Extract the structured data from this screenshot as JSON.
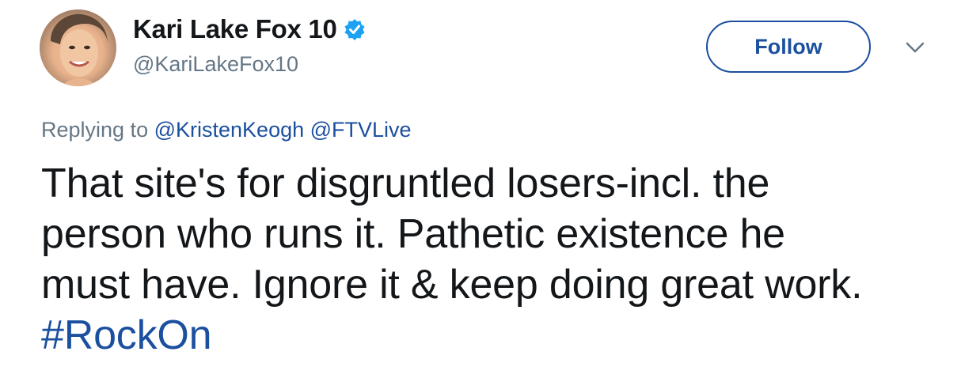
{
  "user": {
    "display_name": "Kari Lake Fox 10",
    "handle": "@KariLakeFox10",
    "verified": true
  },
  "actions": {
    "follow_label": "Follow"
  },
  "reply": {
    "prefix": "Replying to",
    "mentions": [
      "@KristenKeogh",
      "@FTVLive"
    ]
  },
  "tweet": {
    "lines": [
      "That site's for disgruntled losers-incl. the",
      "person who runs it. Pathetic existence he",
      "must have. Ignore it & keep doing great work."
    ],
    "hashtag": "#RockOn"
  },
  "colors": {
    "link": "#1b4f9f",
    "verified_badge": "#1da1f2",
    "muted_text": "#657786",
    "body_text": "#14171a"
  },
  "icons": {
    "verified": "verified-badge-icon",
    "more": "chevron-down-icon"
  }
}
